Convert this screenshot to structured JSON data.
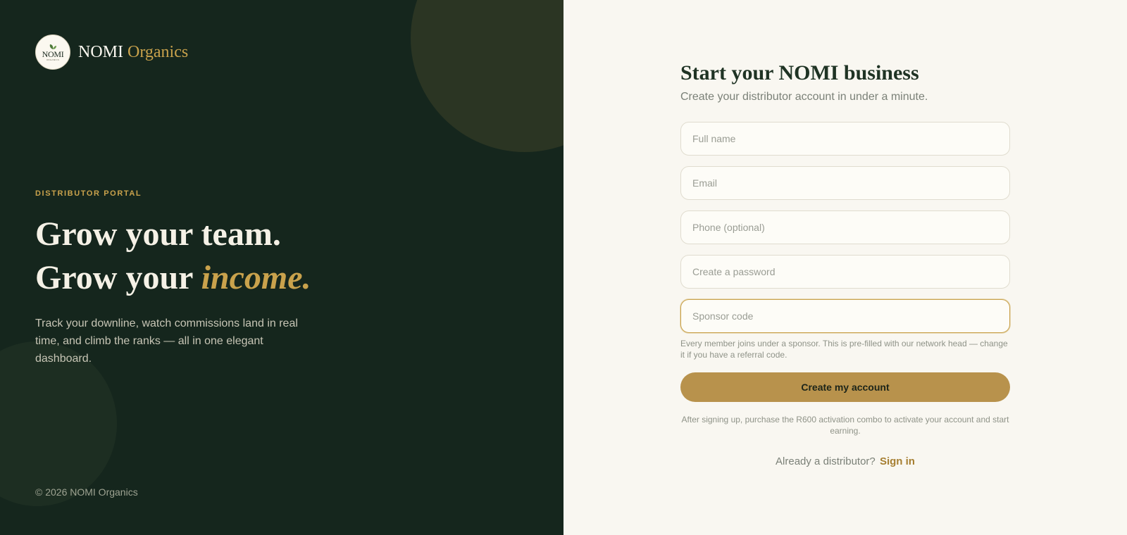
{
  "brand": {
    "logo_word": "NOMI",
    "logo_sub": "ORGANICS",
    "name_primary": "NOMI",
    "name_accent": "Organics"
  },
  "hero": {
    "eyebrow": "DISTRIBUTOR PORTAL",
    "headline_line1": "Grow your team.",
    "headline_line2_start": "Grow your ",
    "headline_line2_emphasis": "income.",
    "description": "Track your downline, watch commissions land in real time, and climb the ranks — all in one elegant dashboard."
  },
  "footer": {
    "copyright": "© 2026 NOMI Organics"
  },
  "form": {
    "title": "Start your NOMI business",
    "subtitle": "Create your distributor account in under a minute.",
    "fields": {
      "full_name": {
        "placeholder": "Full name",
        "value": ""
      },
      "email": {
        "placeholder": "Email",
        "value": ""
      },
      "phone": {
        "placeholder": "Phone (optional)",
        "value": ""
      },
      "password": {
        "placeholder": "Create a password",
        "value": ""
      },
      "sponsor_code": {
        "placeholder": "Sponsor code",
        "value": ""
      }
    },
    "sponsor_hint": "Every member joins under a sponsor. This is pre-filled with our network head — change it if you have a referral code.",
    "submit_label": "Create my account",
    "activation_note": "After signing up, purchase the R600 activation combo to activate your account and start earning.",
    "signin_prompt": "Already a distributor?",
    "signin_link": "Sign in"
  },
  "colors": {
    "left_panel_bg": "#15261d",
    "right_panel_bg": "#f9f7f1",
    "accent_gold": "#c9a24c",
    "button_gold": "#b8924c"
  },
  "icons": {
    "logo": "leaf-icon"
  }
}
